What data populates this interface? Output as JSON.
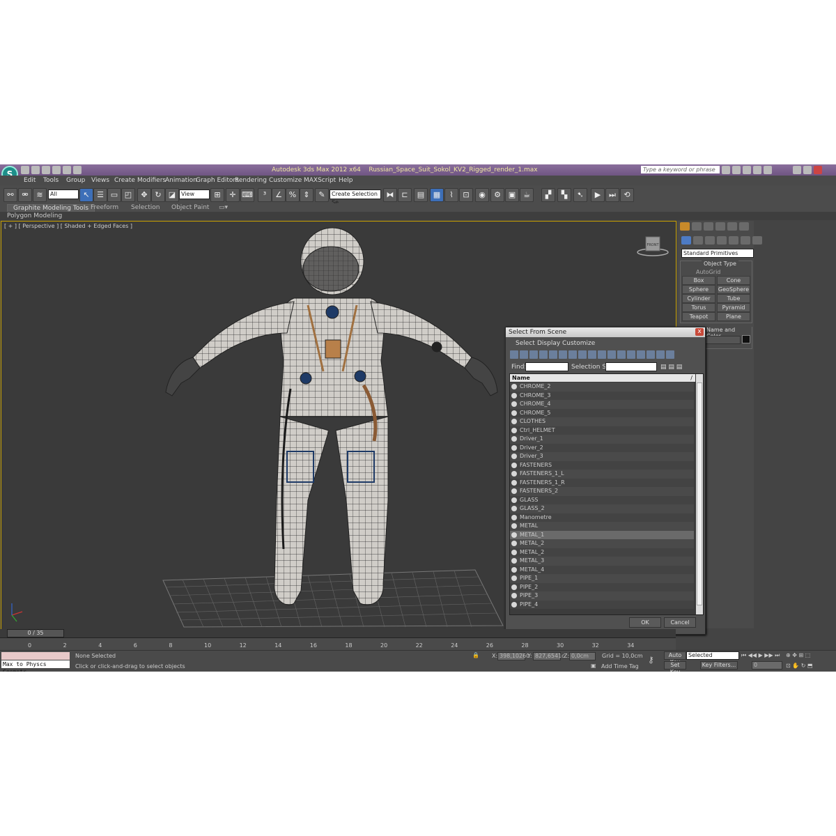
{
  "titlebar": {
    "app": "Autodesk 3ds Max  2012 x64",
    "file": "Russian_Space_Suit_Sokol_KV2_Rigged_render_1.max",
    "search_placeholder": "Type a keyword or phrase",
    "logo": "S"
  },
  "menu": [
    "Edit",
    "Tools",
    "Group",
    "Views",
    "Create",
    "Modifiers",
    "Animation",
    "Graph Editors",
    "Rendering",
    "Customize",
    "MAXScript",
    "Help"
  ],
  "toolbar": {
    "filter_value": "All",
    "coord_value": "View",
    "selection_set_placeholder": "Create Selection Se"
  },
  "ribbon": {
    "tabs": [
      "Graphite Modeling Tools",
      "Freeform",
      "Selection",
      "Object Paint"
    ],
    "sub": "Polygon Modeling"
  },
  "viewport": {
    "label": "[ + ] [ Perspective ] [ Shaded + Edged Faces ]",
    "cube_label": "FRONT"
  },
  "command_panel": {
    "dropdown": "Standard Primitives",
    "group_title": "Object Type",
    "autogrid": "AutoGrid",
    "buttons": [
      "Box",
      "Cone",
      "Sphere",
      "GeoSphere",
      "Cylinder",
      "Tube",
      "Torus",
      "Pyramid",
      "Teapot",
      "Plane"
    ],
    "name_color_title": "Name and Color"
  },
  "dialog": {
    "title": "Select From Scene",
    "close": "x",
    "menu": [
      "Select",
      "Display",
      "Customize"
    ],
    "find_label": "Find:",
    "selection_set_label": "Selection Set:",
    "column_header": "Name",
    "sort_glyph": "/",
    "items": [
      "CHROME_2",
      "CHROME_3",
      "CHROME_4",
      "CHROME_5",
      "CLOTHES",
      "Ctrl_HELMET",
      "Driver_1",
      "Driver_2",
      "Driver_3",
      "FASTENERS",
      "FASTENERS_1_L",
      "FASTENERS_1_R",
      "FASTENERS_2",
      "GLASS",
      "GLASS_2",
      "Manometre",
      "METAL",
      "METAL_1",
      "METAL_2",
      "METAL_2",
      "METAL_3",
      "METAL_4",
      "PIPE_1",
      "PIPE_2",
      "PIPE_3",
      "PIPE_4"
    ],
    "ok": "OK",
    "cancel": "Cancel"
  },
  "timeline": {
    "frame": "0 / 35",
    "ticks": [
      "0",
      "2",
      "4",
      "6",
      "8",
      "10",
      "12",
      "14",
      "16",
      "18",
      "20",
      "22",
      "24",
      "26",
      "28",
      "30",
      "32",
      "34"
    ]
  },
  "status": {
    "maxscript": "Max to Physcs Geometr",
    "selected": "None Selected",
    "prompt": "Click or click-and-drag to select objects",
    "x_label": "X:",
    "x_value": "398,10260",
    "y_label": "Y:",
    "y_value": "827,6541c",
    "z_label": "Z:",
    "z_value": "0,0cm",
    "grid": "Grid = 10,0cm",
    "add_time_tag": "Add Time Tag",
    "auto_key": "Auto Key",
    "set_key": "Set Key",
    "selected_dropdown": "Selected",
    "key_filters": "Key Filters...",
    "frame_value": "0"
  }
}
